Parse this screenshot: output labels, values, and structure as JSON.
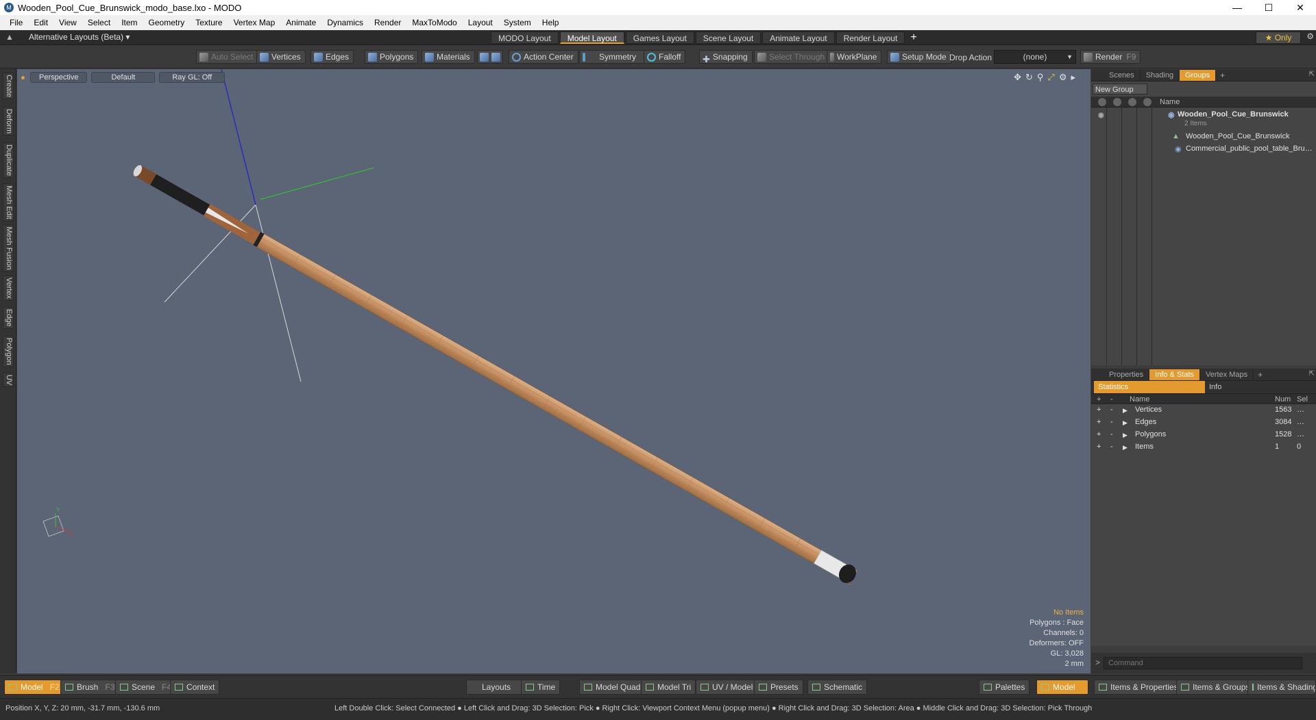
{
  "window": {
    "title": "Wooden_Pool_Cue_Brunswick_modo_base.lxo - MODO",
    "controls": [
      "—",
      "☐",
      "✕"
    ]
  },
  "menu": [
    "File",
    "Edit",
    "View",
    "Select",
    "Item",
    "Geometry",
    "Texture",
    "Vertex Map",
    "Animate",
    "Dynamics",
    "Render",
    "MaxToModo",
    "Layout",
    "System",
    "Help"
  ],
  "layout_bar": {
    "alt_layouts": "Alternative Layouts (Beta) ▾",
    "tabs": [
      "MODO Layout",
      "Model Layout",
      "Games Layout",
      "Scene Layout",
      "Animate Layout",
      "Render Layout"
    ],
    "active_tab": "Model Layout",
    "plus": "+",
    "only": "★ Only"
  },
  "toolbar": {
    "auto_select": "Auto Select",
    "vertices": "Vertices",
    "edges": "Edges",
    "polygons": "Polygons",
    "materials": "Materials",
    "action_center": "Action Center",
    "symmetry": "Symmetry",
    "falloff": "Falloff",
    "snapping": "Snapping",
    "select_through": "Select Through",
    "workplane": "WorkPlane",
    "setup_mode": "Setup Mode",
    "drop_action_label": "Drop Action",
    "drop_action_value": "(none)",
    "render": "Render",
    "render_key": "F9"
  },
  "left_tabs": [
    "Create",
    "Deform",
    "Duplicate",
    "Mesh Edit",
    "Mesh Fusion",
    "Vertex",
    "Edge",
    "Polygon",
    "UV"
  ],
  "viewport": {
    "view": "Perspective",
    "shading": "Default",
    "raygl": "Ray GL: Off",
    "stats": {
      "no_items": "No Items",
      "polygons": "Polygons : Face",
      "channels": "Channels: 0",
      "deformers": "Deformers: OFF",
      "gl": "GL: 3,028",
      "scale": "2 mm"
    },
    "colors": {
      "background": "#5c6575",
      "wood": "#c8966a",
      "x_axis": "#30c030",
      "y_axis": "#2020d0"
    }
  },
  "groups_panel": {
    "tabs": [
      "Scenes",
      "Shading",
      "Groups"
    ],
    "active_tab": "Groups",
    "new_group": "New Group",
    "name_header": "Name",
    "group_name": "Wooden_Pool_Cue_Brunswick",
    "group_count": "2 Items",
    "items": [
      "Wooden_Pool_Cue_Brunswick",
      "Commercial_public_pool_table_Bru…"
    ]
  },
  "stats_panel": {
    "tabs": [
      "Properties",
      "Info & Stats",
      "Vertex Maps"
    ],
    "active_tab": "Info & Stats",
    "sub_tabs": [
      "Statistics",
      "Info"
    ],
    "headers": {
      "name": "Name",
      "num": "Num",
      "sel": "Sel"
    },
    "rows": [
      {
        "name": "Vertices",
        "num": "1563",
        "sel": "…"
      },
      {
        "name": "Edges",
        "num": "3084",
        "sel": "…"
      },
      {
        "name": "Polygons",
        "num": "1528",
        "sel": "…"
      },
      {
        "name": "Items",
        "num": "1",
        "sel": "0"
      }
    ],
    "command_placeholder": "Command"
  },
  "bottom_bar": {
    "model": "Model",
    "model_key": "F2",
    "brush": "Brush",
    "brush_key": "F3",
    "scene": "Scene",
    "scene_key": "F4",
    "context": "Context",
    "layouts": "Layouts",
    "time": "Time",
    "model_quad": "Model Quad",
    "model_tri": "Model Tri",
    "uv_model": "UV / Model",
    "presets": "Presets",
    "schematic": "Schematic",
    "palettes": "Palettes",
    "model_right": "Model",
    "items_properties": "Items & Properties",
    "items_groups": "Items & Groups",
    "items_shading": "Items & Shading"
  },
  "status_bar": {
    "position": "Position X, Y, Z:   20 mm, -31.7 mm, -130.6 mm",
    "hint": "Left Double Click: Select Connected ● Left Click and Drag: 3D Selection: Pick ● Right Click: Viewport Context Menu (popup menu) ● Right Click and Drag: 3D Selection: Area ● Middle Click and Drag: 3D Selection: Pick Through"
  }
}
